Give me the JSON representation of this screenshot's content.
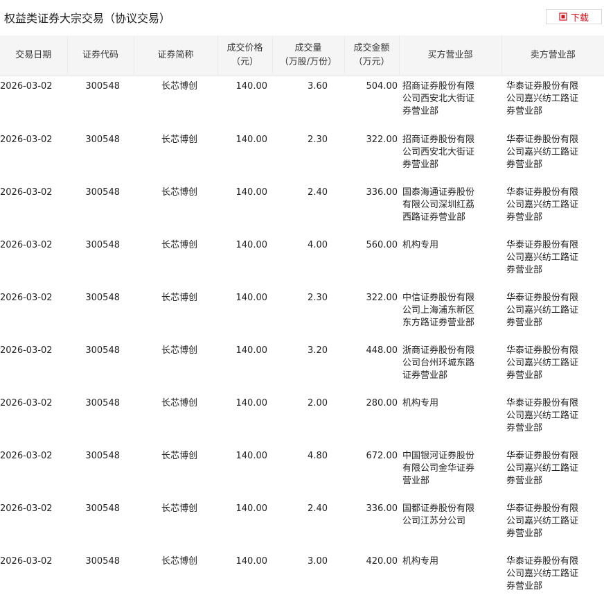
{
  "header": {
    "title": "权益类证券大宗交易（协议交易）",
    "download_label": "下载",
    "download_icon": "download-icon",
    "accent_color": "#c81623"
  },
  "table": {
    "columns": [
      {
        "line1": "交易日期",
        "line2": ""
      },
      {
        "line1": "证券代码",
        "line2": ""
      },
      {
        "line1": "证券简称",
        "line2": ""
      },
      {
        "line1": "成交价格",
        "line2": "（元）"
      },
      {
        "line1": "成交量",
        "line2": "（万股/万份）"
      },
      {
        "line1": "成交金额",
        "line2": "（万元）"
      },
      {
        "line1": "买方营业部",
        "line2": ""
      },
      {
        "line1": "卖方营业部",
        "line2": ""
      }
    ],
    "rows": [
      {
        "date": "2026-03-02",
        "code": "300548",
        "name": "长芯博创",
        "price": "140.00",
        "volume": "3.60",
        "amount": "504.00",
        "buyer": "招商证券股份有限公司西安北大街证券营业部",
        "seller": "华泰证券股份有限公司嘉兴纺工路证券营业部"
      },
      {
        "date": "2026-03-02",
        "code": "300548",
        "name": "长芯博创",
        "price": "140.00",
        "volume": "2.30",
        "amount": "322.00",
        "buyer": "招商证券股份有限公司西安北大街证券营业部",
        "seller": "华泰证券股份有限公司嘉兴纺工路证券营业部"
      },
      {
        "date": "2026-03-02",
        "code": "300548",
        "name": "长芯博创",
        "price": "140.00",
        "volume": "2.40",
        "amount": "336.00",
        "buyer": "国泰海通证券股份有限公司深圳红荔西路证券营业部",
        "seller": "华泰证券股份有限公司嘉兴纺工路证券营业部"
      },
      {
        "date": "2026-03-02",
        "code": "300548",
        "name": "长芯博创",
        "price": "140.00",
        "volume": "4.00",
        "amount": "560.00",
        "buyer": "机构专用",
        "seller": "华泰证券股份有限公司嘉兴纺工路证券营业部"
      },
      {
        "date": "2026-03-02",
        "code": "300548",
        "name": "长芯博创",
        "price": "140.00",
        "volume": "2.30",
        "amount": "322.00",
        "buyer": "中信证券股份有限公司上海浦东新区东方路证券营业部",
        "seller": "华泰证券股份有限公司嘉兴纺工路证券营业部"
      },
      {
        "date": "2026-03-02",
        "code": "300548",
        "name": "长芯博创",
        "price": "140.00",
        "volume": "3.20",
        "amount": "448.00",
        "buyer": "浙商证券股份有限公司台州环城东路证券营业部",
        "seller": "华泰证券股份有限公司嘉兴纺工路证券营业部"
      },
      {
        "date": "2026-03-02",
        "code": "300548",
        "name": "长芯博创",
        "price": "140.00",
        "volume": "2.00",
        "amount": "280.00",
        "buyer": "机构专用",
        "seller": "华泰证券股份有限公司嘉兴纺工路证券营业部"
      },
      {
        "date": "2026-03-02",
        "code": "300548",
        "name": "长芯博创",
        "price": "140.00",
        "volume": "4.80",
        "amount": "672.00",
        "buyer": "中国银河证券股份有限公司金华证券营业部",
        "seller": "华泰证券股份有限公司嘉兴纺工路证券营业部"
      },
      {
        "date": "2026-03-02",
        "code": "300548",
        "name": "长芯博创",
        "price": "140.00",
        "volume": "2.40",
        "amount": "336.00",
        "buyer": "国都证券股份有限公司江苏分公司",
        "seller": "华泰证券股份有限公司嘉兴纺工路证券营业部"
      },
      {
        "date": "2026-03-02",
        "code": "300548",
        "name": "长芯博创",
        "price": "140.00",
        "volume": "3.00",
        "amount": "420.00",
        "buyer": "机构专用",
        "seller": "华泰证券股份有限公司嘉兴纺工路证券营业部"
      }
    ]
  }
}
